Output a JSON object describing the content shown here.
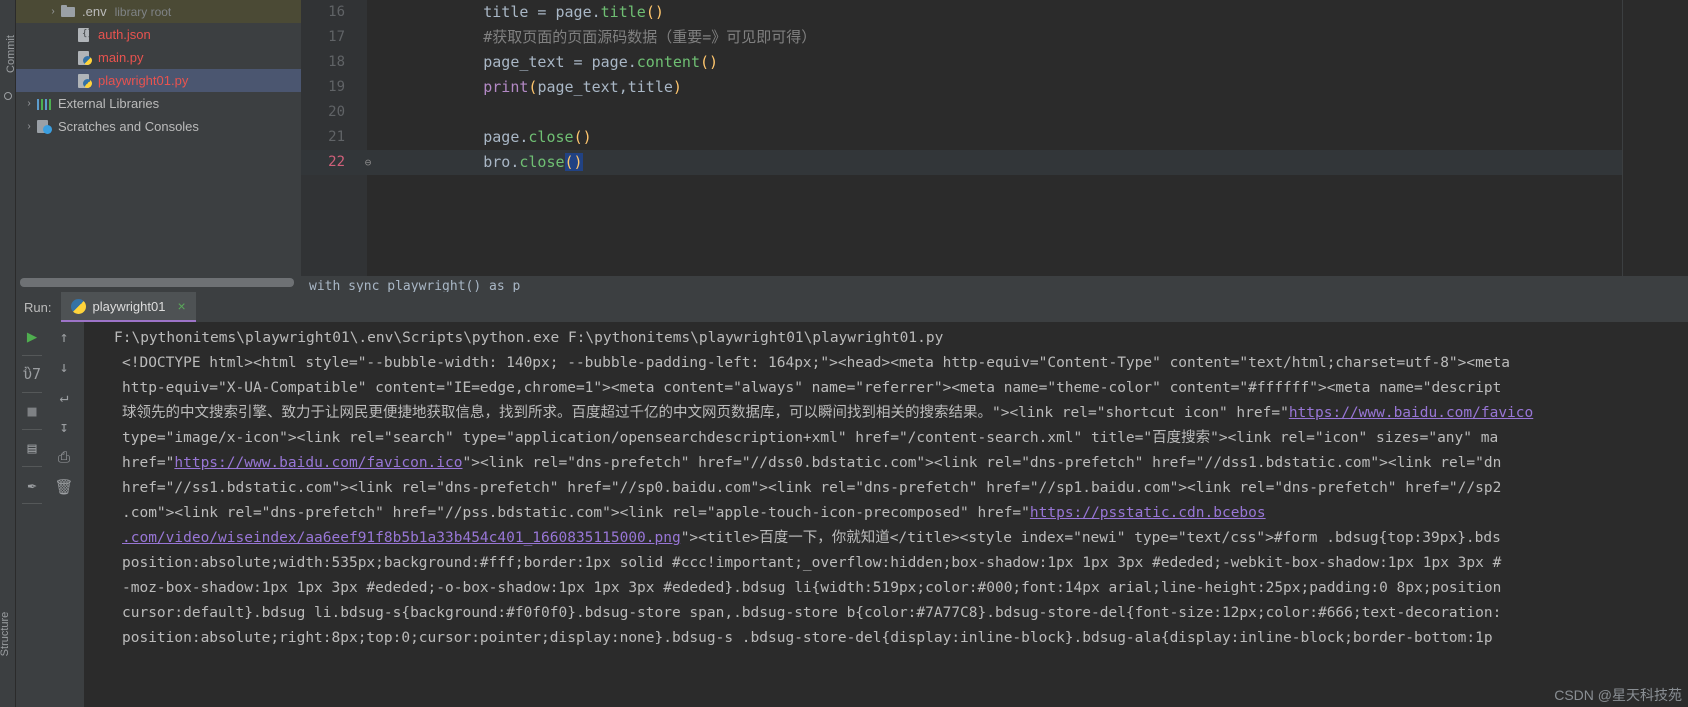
{
  "left_strip": {
    "commit_label": "Commit",
    "structure_label": "Structure"
  },
  "project_tree": {
    "items": [
      {
        "label": ".env",
        "sub": "library root",
        "icon": "folder-icon",
        "arrow": "›",
        "state": "env"
      },
      {
        "label": "auth.json",
        "sub": "",
        "icon": "json-file-icon",
        "arrow": "",
        "state": "normal"
      },
      {
        "label": "main.py",
        "sub": "",
        "icon": "python-file-icon",
        "arrow": "",
        "state": "normal"
      },
      {
        "label": "playwright01.py",
        "sub": "",
        "icon": "python-file-icon",
        "arrow": "",
        "state": "selected"
      },
      {
        "label": "External Libraries",
        "sub": "",
        "icon": "library-icon",
        "arrow": "›",
        "state": "top"
      },
      {
        "label": "Scratches and Consoles",
        "sub": "",
        "icon": "scratches-icon",
        "arrow": "›",
        "state": "top"
      }
    ]
  },
  "editor": {
    "breadcrumb": "with sync_playwright() as p",
    "lines": [
      {
        "num": "16",
        "fold": "",
        "current": false,
        "segments": [
          {
            "t": "        ",
            "c": "t-id"
          },
          {
            "t": "title",
            "c": "t-id"
          },
          {
            "t": " = ",
            "c": "t-punc"
          },
          {
            "t": "page",
            "c": "t-id"
          },
          {
            "t": ".",
            "c": "t-punc"
          },
          {
            "t": "title",
            "c": "t-meth"
          },
          {
            "t": "()",
            "c": "t-paren"
          }
        ]
      },
      {
        "num": "17",
        "fold": "",
        "current": false,
        "segments": [
          {
            "t": "        #获取页面的页面源码数据（重要=》可见即可得）",
            "c": "t-cmt"
          }
        ]
      },
      {
        "num": "18",
        "fold": "",
        "current": false,
        "segments": [
          {
            "t": "        ",
            "c": "t-id"
          },
          {
            "t": "page_text",
            "c": "t-id"
          },
          {
            "t": " = ",
            "c": "t-punc"
          },
          {
            "t": "page",
            "c": "t-id"
          },
          {
            "t": ".",
            "c": "t-punc"
          },
          {
            "t": "content",
            "c": "t-meth"
          },
          {
            "t": "()",
            "c": "t-paren"
          }
        ]
      },
      {
        "num": "19",
        "fold": "",
        "current": false,
        "segments": [
          {
            "t": "        ",
            "c": "t-id"
          },
          {
            "t": "print",
            "c": "t-print"
          },
          {
            "t": "(",
            "c": "t-paren"
          },
          {
            "t": "page_text,title",
            "c": "t-id"
          },
          {
            "t": ")",
            "c": "t-paren"
          }
        ]
      },
      {
        "num": "20",
        "fold": "",
        "current": false,
        "segments": [
          {
            "t": "",
            "c": "t-id"
          }
        ]
      },
      {
        "num": "21",
        "fold": "",
        "current": false,
        "segments": [
          {
            "t": "        ",
            "c": "t-id"
          },
          {
            "t": "page",
            "c": "t-id"
          },
          {
            "t": ".",
            "c": "t-punc"
          },
          {
            "t": "close",
            "c": "t-meth"
          },
          {
            "t": "()",
            "c": "t-paren"
          }
        ]
      },
      {
        "num": "22",
        "fold": "⊖",
        "current": true,
        "segments": [
          {
            "t": "        ",
            "c": "t-id"
          },
          {
            "t": "bro",
            "c": "t-id"
          },
          {
            "t": ".",
            "c": "t-punc"
          },
          {
            "t": "close",
            "c": "t-meth"
          },
          {
            "t": "()",
            "c": "t-paren t-sel"
          }
        ]
      }
    ]
  },
  "run_panel": {
    "run_label": "Run:",
    "tab_label": "playwright01",
    "tab_close": "×",
    "toolbar_left": [
      {
        "name": "rerun-button",
        "glyph": "▶",
        "cls": "run-green"
      },
      {
        "name": "settings-wrench-icon",
        "glyph": "ὒ7",
        "cls": ""
      },
      {
        "name": "stop-button",
        "glyph": "■",
        "cls": "sq"
      },
      {
        "name": "layout-button",
        "glyph": "▤",
        "cls": ""
      },
      {
        "name": "pin-button",
        "glyph": "✒",
        "cls": ""
      }
    ],
    "toolbar_right": [
      {
        "name": "up-arrow-button",
        "glyph": "↑"
      },
      {
        "name": "down-arrow-button",
        "glyph": "↓"
      },
      {
        "name": "soft-wrap-button",
        "glyph": "↵"
      },
      {
        "name": "scroll-to-end-button",
        "glyph": "↧"
      },
      {
        "name": "print-button",
        "glyph": "⎙"
      },
      {
        "name": "trash-button",
        "glyph": "🗑"
      }
    ],
    "console_lines": [
      {
        "pre": "F:\\pythonitems\\playwright01\\.env\\Scripts\\python.exe F:\\pythonitems\\playwright01\\playwright01.py",
        "link": "",
        "post": ""
      },
      {
        "pre": "<!DOCTYPE html><html style=\"--bubble-width: 140px; --bubble-padding-left: 164px;\"><head><meta http-equiv=\"Content-Type\" content=\"text/html;charset=utf-8\"><meta",
        "link": "",
        "post": ""
      },
      {
        "pre": "http-equiv=\"X-UA-Compatible\" content=\"IE=edge,chrome=1\"><meta content=\"always\" name=\"referrer\"><meta name=\"theme-color\" content=\"#ffffff\"><meta name=\"descript",
        "link": "",
        "post": ""
      },
      {
        "pre": "球领先的中文搜索引擎、致力于让网民更便捷地获取信息，找到所求。百度超过千亿的中文网页数据库，可以瞬间找到相关的搜索结果。\"><link rel=\"shortcut icon\" href=\"",
        "link": "https://www.baidu.com/favico",
        "post": ""
      },
      {
        "pre": "type=\"image/x-icon\"><link rel=\"search\" type=\"application/opensearchdescription+xml\" href=\"/content-search.xml\" title=\"百度搜索\"><link rel=\"icon\" sizes=\"any\" ma",
        "link": "",
        "post": ""
      },
      {
        "pre": "href=\"",
        "link": "https://www.baidu.com/favicon.ico",
        "post": "\"><link rel=\"dns-prefetch\" href=\"//dss0.bdstatic.com\"><link rel=\"dns-prefetch\" href=\"//dss1.bdstatic.com\"><link rel=\"dn"
      },
      {
        "pre": "href=\"//ss1.bdstatic.com\"><link rel=\"dns-prefetch\" href=\"//sp0.baidu.com\"><link rel=\"dns-prefetch\" href=\"//sp1.baidu.com\"><link rel=\"dns-prefetch\" href=\"//sp2",
        "link": "",
        "post": ""
      },
      {
        "pre": ".com\"><link rel=\"dns-prefetch\" href=\"//pss.bdstatic.com\"><link rel=\"apple-touch-icon-precomposed\" href=\"",
        "link": "https://psstatic.cdn.bcebos",
        "post": ""
      },
      {
        "pre": "",
        "link": ".com/video/wiseindex/aa6eef91f8b5b1a33b454c401_1660835115000.png",
        "post": "\"><title>百度一下，你就知道</title><style index=\"newi\" type=\"text/css\">#form .bdsug{top:39px}.bds"
      },
      {
        "pre": "position:absolute;width:535px;background:#fff;border:1px solid #ccc!important;_overflow:hidden;box-shadow:1px 1px 3px #ededed;-webkit-box-shadow:1px 1px 3px #",
        "link": "",
        "post": ""
      },
      {
        "pre": "-moz-box-shadow:1px 1px 3px #ededed;-o-box-shadow:1px 1px 3px #ededed}.bdsug li{width:519px;color:#000;font:14px arial;line-height:25px;padding:0 8px;position",
        "link": "",
        "post": ""
      },
      {
        "pre": "cursor:default}.bdsug li.bdsug-s{background:#f0f0f0}.bdsug-store span,.bdsug-store b{color:#7A77C8}.bdsug-store-del{font-size:12px;color:#666;text-decoration:",
        "link": "",
        "post": ""
      },
      {
        "pre": "position:absolute;right:8px;top:0;cursor:pointer;display:none}.bdsug-s .bdsug-store-del{display:inline-block}.bdsug-ala{display:inline-block;border-bottom:1p",
        "link": "",
        "post": ""
      }
    ],
    "watermark": "CSDN @星天科技苑"
  }
}
